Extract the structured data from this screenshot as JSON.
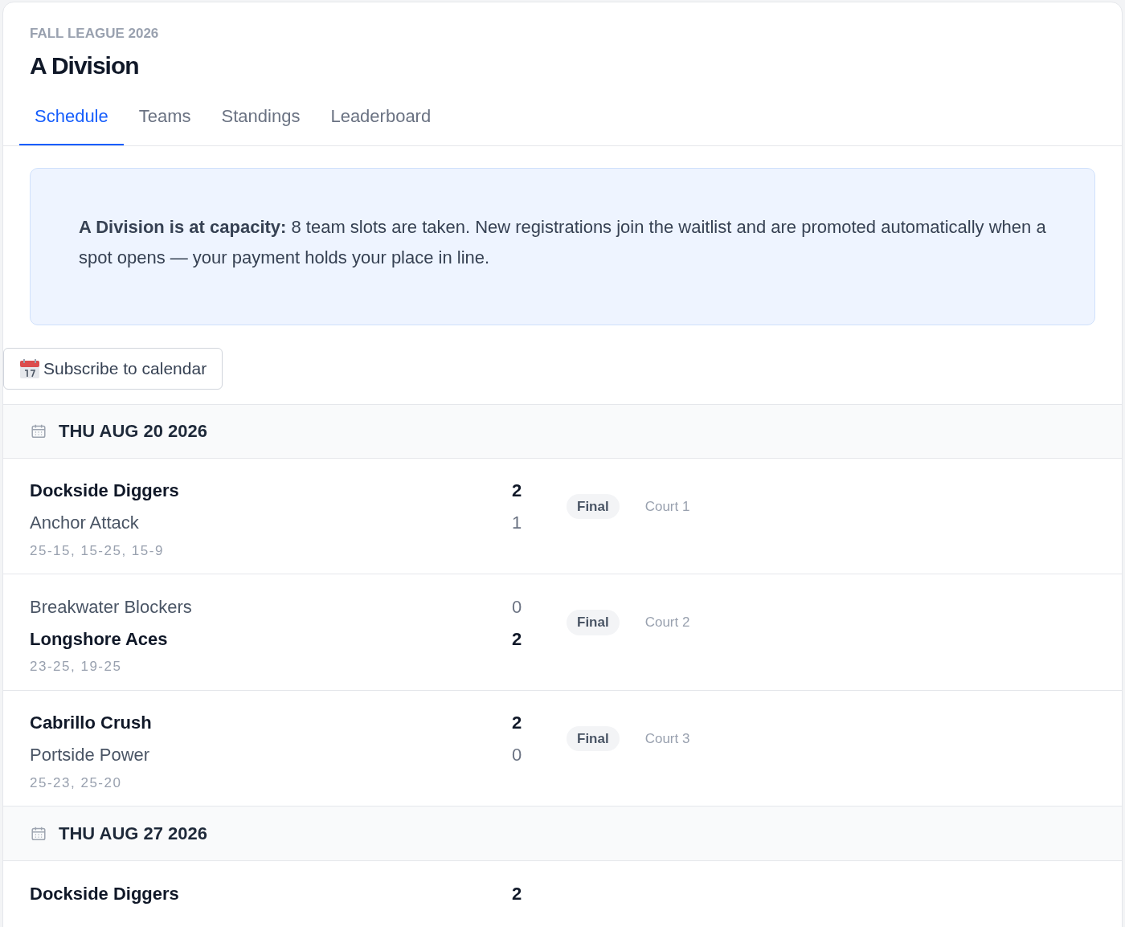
{
  "header": {
    "eyebrow": "FALL LEAGUE 2026",
    "title": "A Division"
  },
  "tabs": [
    {
      "label": "Schedule",
      "selected": true
    },
    {
      "label": "Teams",
      "selected": false
    },
    {
      "label": "Standings",
      "selected": false
    },
    {
      "label": "Leaderboard",
      "selected": false
    }
  ],
  "notice": {
    "text": "**A Division is at capacity:** 8 team slots are taken. New registrations join the waitlist and are promoted automatically when a spot opens — your payment holds your place in line."
  },
  "subscribe_button": {
    "label": "Subscribe to calendar"
  },
  "days": [
    {
      "date": "THU AUG 20 2026",
      "matches": [
        {
          "teams": [
            {
              "name": "Dockside Diggers",
              "score": "2",
              "winner": true
            },
            {
              "name": "Anchor Attack",
              "score": "1",
              "winner": false
            }
          ],
          "sets": "25-15, 15-25, 15-9",
          "status": "Final",
          "court": "Court 1"
        },
        {
          "teams": [
            {
              "name": "Breakwater Blockers",
              "score": "0",
              "winner": false
            },
            {
              "name": "Longshore Aces",
              "score": "2",
              "winner": true
            }
          ],
          "sets": "23-25, 19-25",
          "status": "Final",
          "court": "Court 2"
        },
        {
          "teams": [
            {
              "name": "Cabrillo Crush",
              "score": "2",
              "winner": true
            },
            {
              "name": "Portside Power",
              "score": "0",
              "winner": false
            }
          ],
          "sets": "25-23, 25-20",
          "status": "Final",
          "court": "Court 3"
        }
      ]
    },
    {
      "date": "THU AUG 27 2026",
      "matches": [
        {
          "teams": [
            {
              "name": "Dockside Diggers",
              "score": "2",
              "winner": true
            }
          ]
        }
      ]
    }
  ]
}
